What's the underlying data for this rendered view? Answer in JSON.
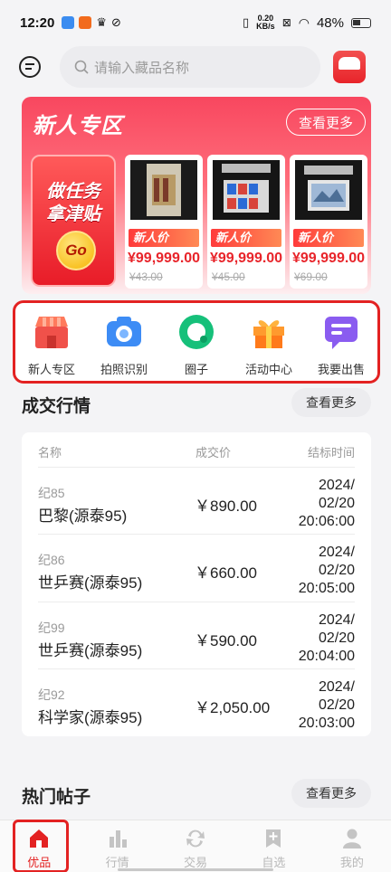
{
  "status_bar": {
    "time": "12:20",
    "net_speed_value": "0.20",
    "net_speed_unit": "KB/s",
    "battery": "48%"
  },
  "search": {
    "placeholder": "请输入藏品名称"
  },
  "promo": {
    "title": "新人专区",
    "more_label": "查看更多",
    "task_line1": "做任务",
    "task_line2": "拿津贴",
    "go_label": "Go",
    "items": [
      {
        "tag": "新人价",
        "price": "¥99,999.00",
        "old_price": "¥43.00"
      },
      {
        "tag": "新人价",
        "price": "¥99,999.00",
        "old_price": "¥45.00"
      },
      {
        "tag": "新人价",
        "price": "¥99,999.00",
        "old_price": "¥69.00"
      }
    ]
  },
  "quick_menu": [
    {
      "label": "新人专区",
      "icon": "shop-icon"
    },
    {
      "label": "拍照识别",
      "icon": "camera-icon"
    },
    {
      "label": "圈子",
      "icon": "circle-icon"
    },
    {
      "label": "活动中心",
      "icon": "gift-icon"
    },
    {
      "label": "我要出售",
      "icon": "sell-icon"
    }
  ],
  "deals": {
    "title": "成交行情",
    "more_label": "查看更多",
    "headers": {
      "name": "名称",
      "price": "成交价",
      "time": "结标时间"
    },
    "rows": [
      {
        "code": "纪85",
        "name": "巴黎(源泰95)",
        "price": "￥890.00",
        "date": "2024/",
        "date2": "02/20",
        "clock": "20:06:00"
      },
      {
        "code": "纪86",
        "name": "世乒赛(源泰95)",
        "price": "￥660.00",
        "date": "2024/",
        "date2": "02/20",
        "clock": "20:05:00"
      },
      {
        "code": "纪99",
        "name": "世乒赛(源泰95)",
        "price": "￥590.00",
        "date": "2024/",
        "date2": "02/20",
        "clock": "20:04:00"
      },
      {
        "code": "纪92",
        "name": "科学家(源泰95)",
        "price": "￥2,050.00",
        "date": "2024/",
        "date2": "02/20",
        "clock": "20:03:00"
      }
    ]
  },
  "hot_posts": {
    "title": "热门帖子",
    "more_label": "查看更多"
  },
  "tabbar": [
    {
      "label": "优品",
      "icon": "home-icon",
      "active": true
    },
    {
      "label": "行情",
      "icon": "bar-chart-icon",
      "active": false
    },
    {
      "label": "交易",
      "icon": "exchange-icon",
      "active": false
    },
    {
      "label": "自选",
      "icon": "bookmark-plus-icon",
      "active": false
    },
    {
      "label": "我的",
      "icon": "user-icon",
      "active": false
    }
  ],
  "colors": {
    "accent": "#e32222",
    "promo_red": "#f8475f"
  }
}
